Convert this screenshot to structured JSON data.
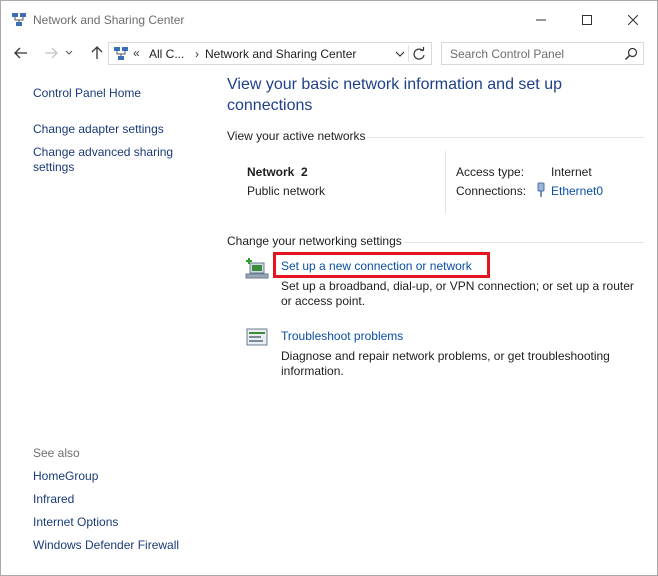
{
  "window": {
    "title": "Network and Sharing Center",
    "icon": "network-center-icon"
  },
  "navigation": {
    "back_icon": "arrow-left-icon",
    "forward_icon": "arrow-right-icon",
    "recent_icon": "chevron-down-icon",
    "up_icon": "arrow-up-icon",
    "breadcrumb_chevron": "«",
    "breadcrumb_1": "All C...",
    "breadcrumb_separator": "›",
    "breadcrumb_2": "Network and Sharing Center",
    "search_placeholder": "Search Control Panel"
  },
  "sidebar": {
    "home": "Control Panel Home",
    "adapter": "Change adapter settings",
    "advanced_sharing": "Change advanced sharing settings",
    "see_also": "See also",
    "see_also_items": [
      "HomeGroup",
      "Infrared",
      "Internet Options",
      "Windows Defender Firewall"
    ]
  },
  "main": {
    "heading": "View your basic network information and set up connections",
    "active_networks_label": "View your active networks",
    "network": {
      "name": "Network  2",
      "type": "Public network",
      "access_type_label": "Access type:",
      "access_type_value": "Internet",
      "connections_label": "Connections:",
      "connection_name": "Ethernet0"
    },
    "change_settings_label": "Change your networking settings",
    "tasks": [
      {
        "label": "Set up a new connection or network",
        "description": "Set up a broadband, dial-up, or VPN connection; or set up a router or access point.",
        "icon": "new-connection-icon"
      },
      {
        "label": "Troubleshoot problems",
        "description": "Diagnose and repair network problems, or get troubleshooting information.",
        "icon": "troubleshoot-icon"
      }
    ]
  },
  "colors": {
    "link": "#0a4ea6",
    "heading": "#1e3f8a",
    "highlight": "#e6141e"
  }
}
